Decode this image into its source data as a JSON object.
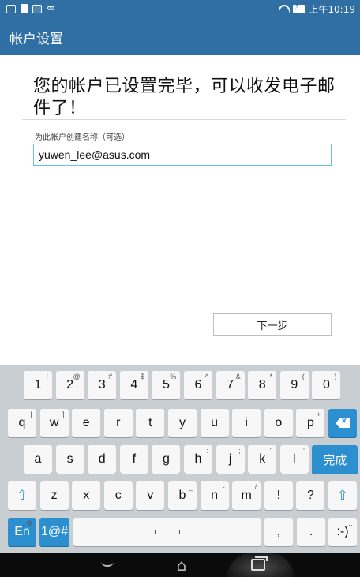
{
  "status_bar": {
    "time": "上午10:19",
    "left_icons": [
      "keyboard-icon",
      "document-icon",
      "image-icon",
      "infinity-icon"
    ],
    "right_icons": [
      "wifi-icon",
      "battery-charging-icon"
    ]
  },
  "app_bar": {
    "title": "帐户设置"
  },
  "main": {
    "headline": "您的帐户已设置完毕，可以收发电子邮件了！",
    "field_label": "为此帐户创建名称（可选）",
    "name_value": "yuwen_lee@asus.com",
    "next_button": "下一步"
  },
  "keyboard": {
    "row1": [
      {
        "key": "1",
        "hint": "!"
      },
      {
        "key": "2",
        "hint": "@"
      },
      {
        "key": "3",
        "hint": "#"
      },
      {
        "key": "4",
        "hint": "$"
      },
      {
        "key": "5",
        "hint": "%"
      },
      {
        "key": "6",
        "hint": "^"
      },
      {
        "key": "7",
        "hint": "&"
      },
      {
        "key": "8",
        "hint": "*"
      },
      {
        "key": "9",
        "hint": "("
      },
      {
        "key": "0",
        "hint": ")"
      }
    ],
    "row2": [
      {
        "key": "q",
        "hint": "["
      },
      {
        "key": "w",
        "hint": "]"
      },
      {
        "key": "e",
        "hint": ""
      },
      {
        "key": "r",
        "hint": ""
      },
      {
        "key": "t",
        "hint": ""
      },
      {
        "key": "y",
        "hint": ""
      },
      {
        "key": "u",
        "hint": ""
      },
      {
        "key": "i",
        "hint": ""
      },
      {
        "key": "o",
        "hint": ""
      },
      {
        "key": "p",
        "hint": "+"
      }
    ],
    "row3": [
      {
        "key": "a",
        "hint": ""
      },
      {
        "key": "s",
        "hint": ""
      },
      {
        "key": "d",
        "hint": ""
      },
      {
        "key": "f",
        "hint": ""
      },
      {
        "key": "g",
        "hint": ""
      },
      {
        "key": "h",
        "hint": ":"
      },
      {
        "key": "j",
        "hint": ";"
      },
      {
        "key": "k",
        "hint": "\""
      },
      {
        "key": "l",
        "hint": "'"
      }
    ],
    "done_label": "完成",
    "row4": [
      {
        "key": "z",
        "hint": ""
      },
      {
        "key": "x",
        "hint": ""
      },
      {
        "key": "c",
        "hint": ""
      },
      {
        "key": "v",
        "hint": ""
      },
      {
        "key": "b",
        "hint": "_"
      },
      {
        "key": "n",
        "hint": "-"
      },
      {
        "key": "m",
        "hint": "/"
      },
      {
        "key": "!",
        "hint": ""
      },
      {
        "key": "?",
        "hint": ""
      }
    ],
    "lang_label": "En",
    "lang_hint": "..⚙",
    "symbols_label": "1@#",
    "comma_label": ",",
    "period_label": ".",
    "smiley_label": ":-)",
    "smiley_hint": "…"
  }
}
